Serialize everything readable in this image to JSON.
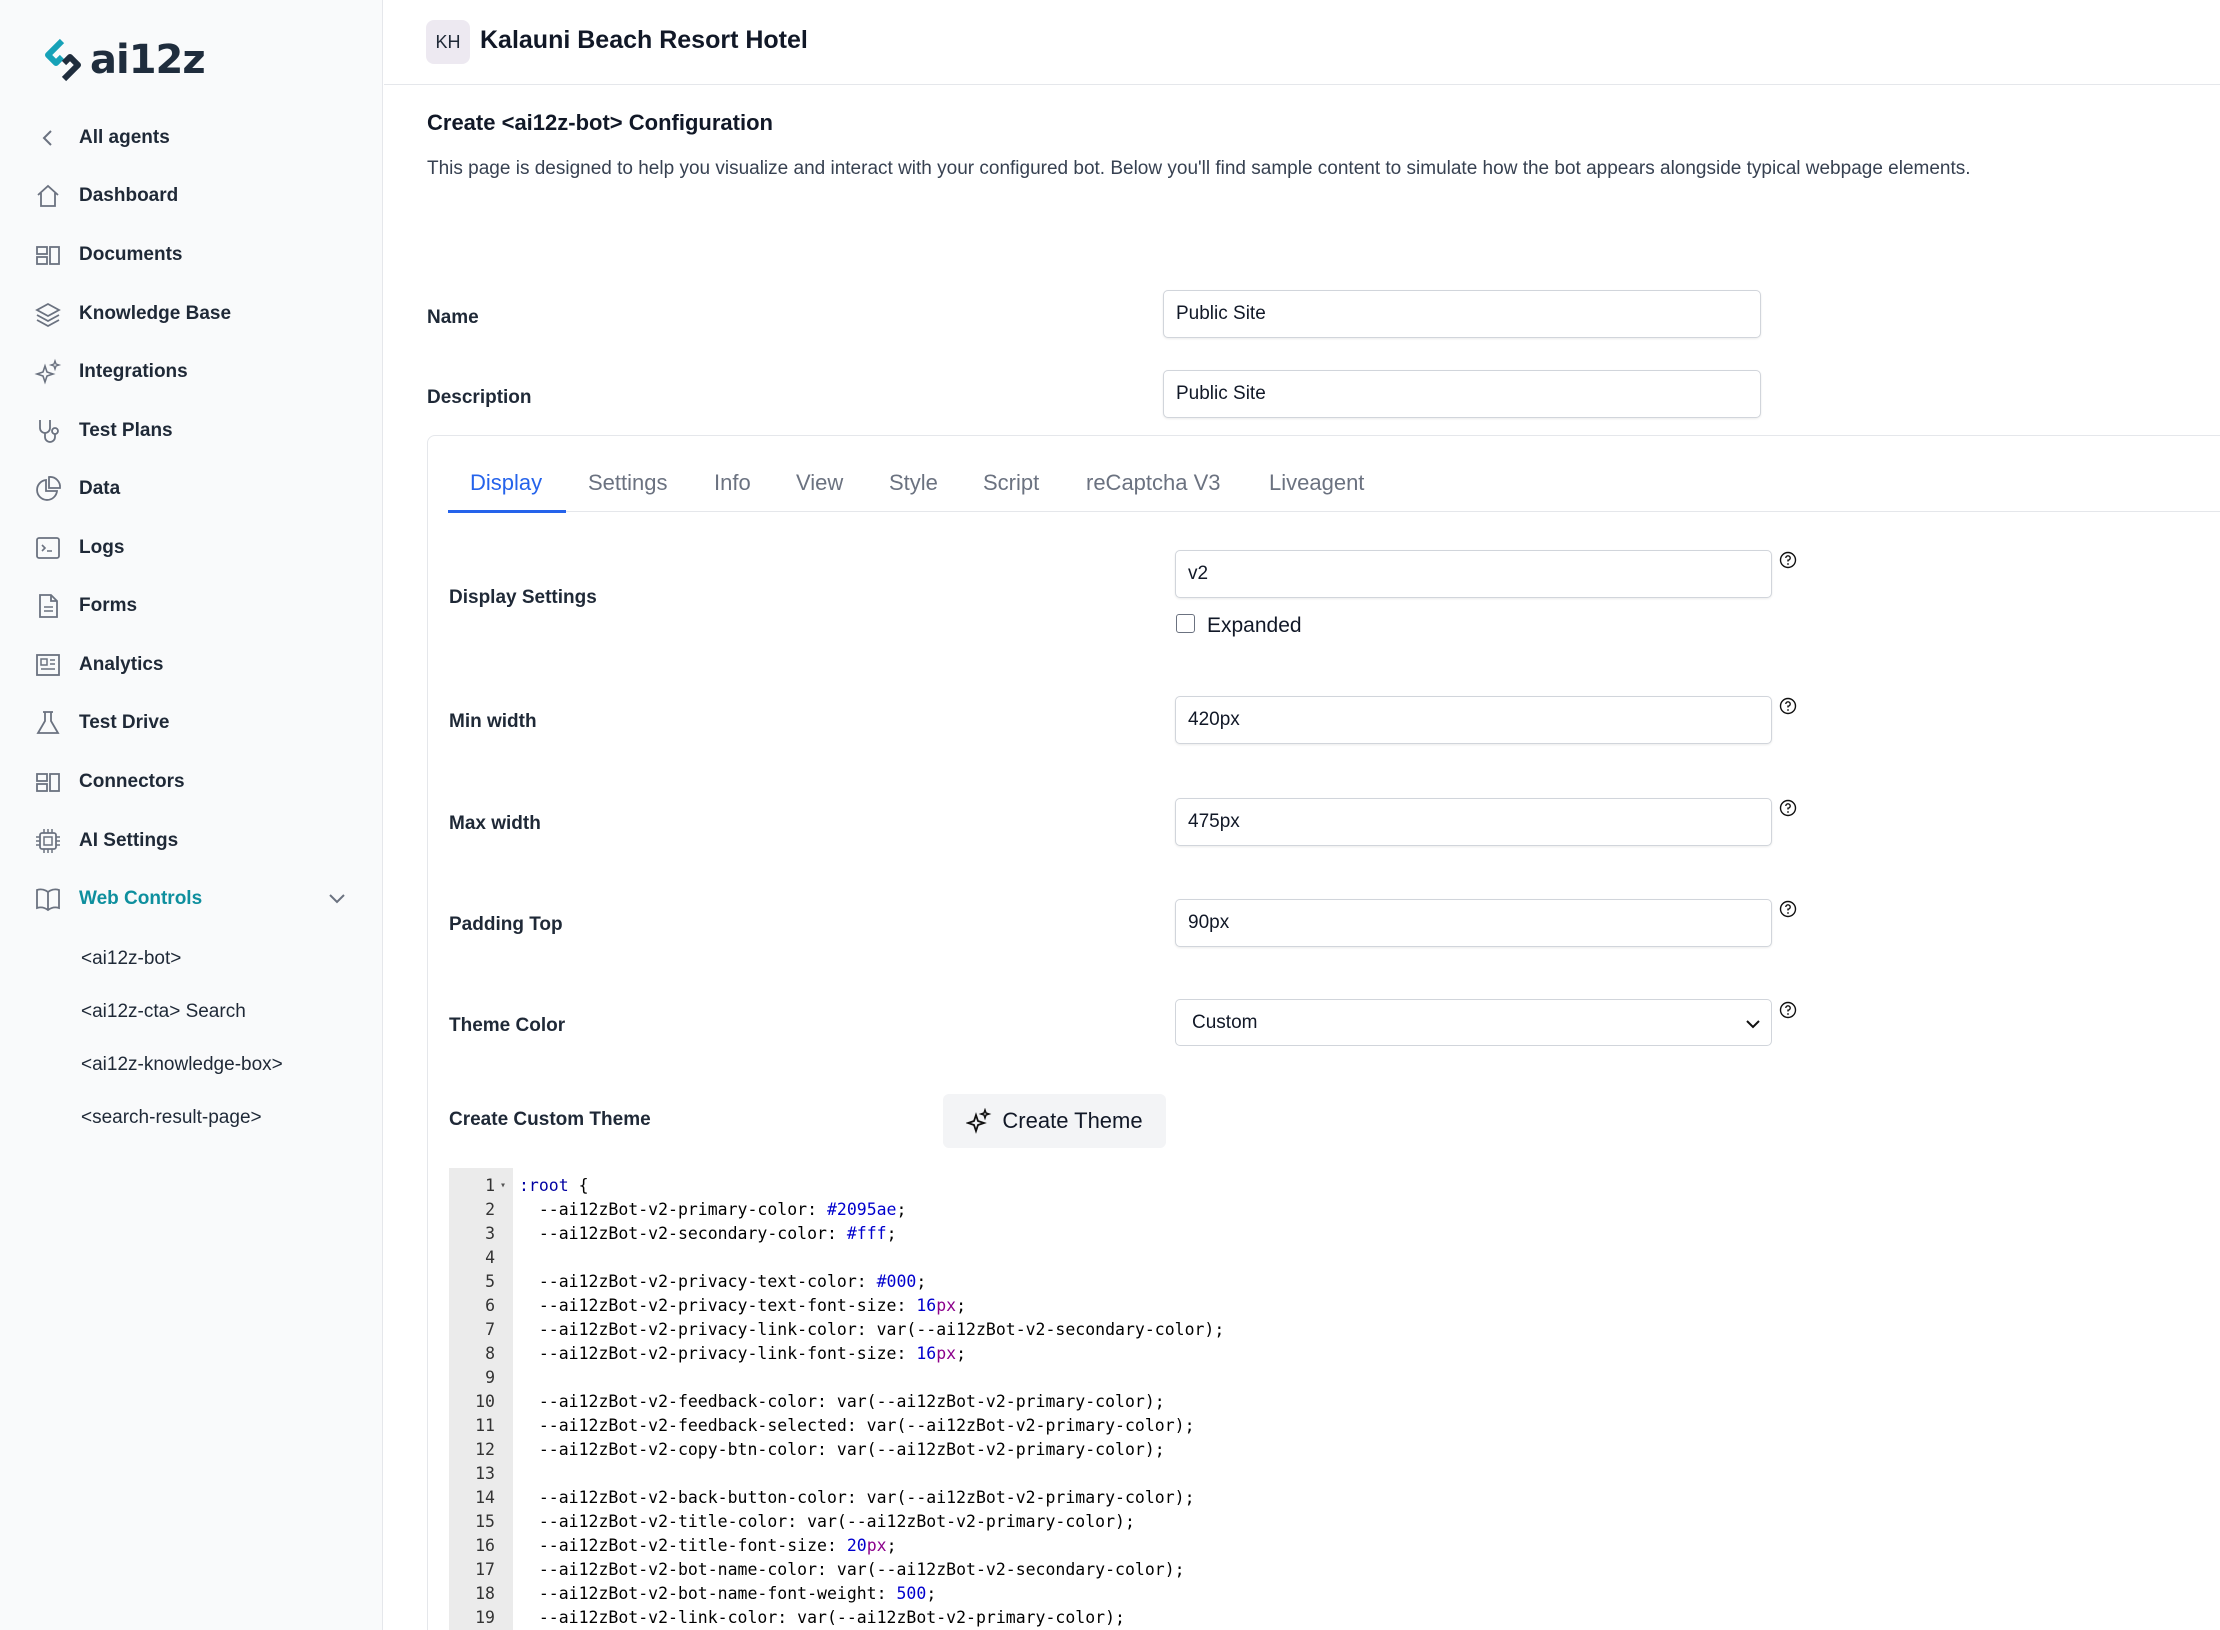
{
  "brand": {
    "logo_text": "ai12z"
  },
  "sidebar": {
    "back_label": "All agents",
    "items": [
      {
        "label": "Dashboard",
        "icon": "home-icon"
      },
      {
        "label": "Documents",
        "icon": "documents-icon"
      },
      {
        "label": "Knowledge Base",
        "icon": "layers-icon"
      },
      {
        "label": "Integrations",
        "icon": "sparkles-icon"
      },
      {
        "label": "Test Plans",
        "icon": "stethoscope-icon"
      },
      {
        "label": "Data",
        "icon": "pie-chart-icon"
      },
      {
        "label": "Logs",
        "icon": "terminal-icon"
      },
      {
        "label": "Forms",
        "icon": "file-icon"
      },
      {
        "label": "Analytics",
        "icon": "newspaper-icon"
      },
      {
        "label": "Test Drive",
        "icon": "flask-icon"
      },
      {
        "label": "Connectors",
        "icon": "connectors-icon"
      },
      {
        "label": "AI Settings",
        "icon": "cpu-icon"
      },
      {
        "label": "Web Controls",
        "icon": "book-open-icon"
      }
    ],
    "sub_items": [
      "<ai12z-bot>",
      "<ai12z-cta> Search",
      "<ai12z-knowledge-box>",
      "<search-result-page>"
    ]
  },
  "header": {
    "avatar_initials": "KH",
    "site_title": "Kalauni Beach Resort Hotel"
  },
  "main": {
    "title": "Create <ai12z-bot> Configuration",
    "description": "This page is designed to help you visualize and interact with your configured bot. Below you'll find sample content to simulate how the bot appears alongside typical webpage elements.",
    "name_label": "Name",
    "name_value": "Public Site",
    "description_label": "Description",
    "description_value": "Public Site"
  },
  "tabs": [
    "Display",
    "Settings",
    "Info",
    "View",
    "Style",
    "Script",
    "reCaptcha V3",
    "Liveagent"
  ],
  "active_tab": "Display",
  "display": {
    "display_settings_label": "Display Settings",
    "display_settings_value": "v2",
    "expanded_label": "Expanded",
    "expanded_checked": false,
    "min_width_label": "Min width",
    "min_width_value": "420px",
    "max_width_label": "Max width",
    "max_width_value": "475px",
    "padding_top_label": "Padding Top",
    "padding_top_value": "90px",
    "theme_color_label": "Theme Color",
    "theme_color_value": "Custom",
    "custom_theme_label": "Create Custom Theme",
    "create_theme_button": "Create Theme"
  },
  "code": {
    "lines": [
      ":root {",
      "  --ai12zBot-v2-primary-color: #2095ae;",
      "  --ai12zBot-v2-secondary-color: #fff;",
      "",
      "  --ai12zBot-v2-privacy-text-color: #000;",
      "  --ai12zBot-v2-privacy-text-font-size: 16px;",
      "  --ai12zBot-v2-privacy-link-color: var(--ai12zBot-v2-secondary-color);",
      "  --ai12zBot-v2-privacy-link-font-size: 16px;",
      "",
      "  --ai12zBot-v2-feedback-color: var(--ai12zBot-v2-primary-color);",
      "  --ai12zBot-v2-feedback-selected: var(--ai12zBot-v2-primary-color);",
      "  --ai12zBot-v2-copy-btn-color: var(--ai12zBot-v2-primary-color);",
      "",
      "  --ai12zBot-v2-back-button-color: var(--ai12zBot-v2-primary-color);",
      "  --ai12zBot-v2-title-color: var(--ai12zBot-v2-primary-color);",
      "  --ai12zBot-v2-title-font-size: 20px;",
      "  --ai12zBot-v2-bot-name-color: var(--ai12zBot-v2-secondary-color);",
      "  --ai12zBot-v2-bot-name-font-weight: 500;",
      "  --ai12zBot-v2-link-color: var(--ai12zBot-v2-primary-color);"
    ]
  },
  "colors": {
    "accent": "#0e8f9e",
    "tab_active": "#2563eb"
  }
}
